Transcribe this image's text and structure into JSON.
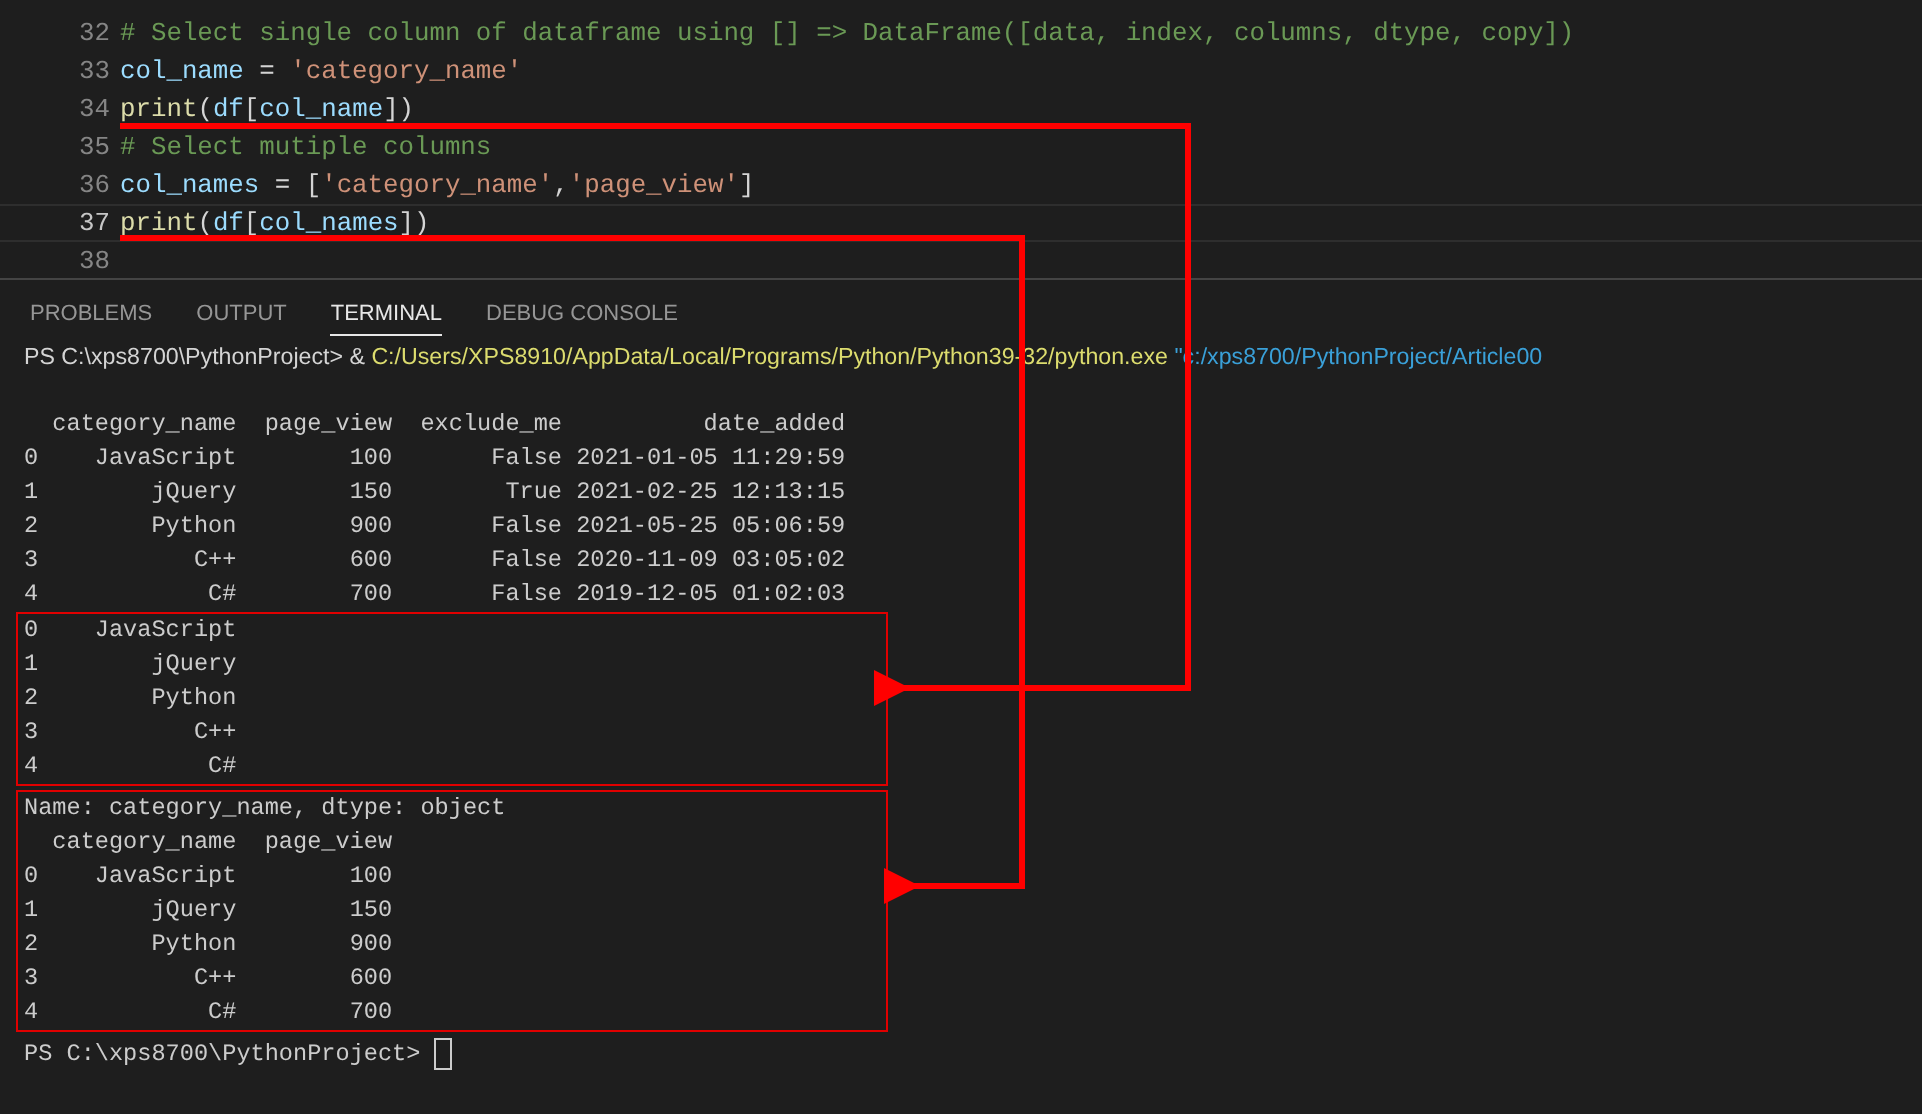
{
  "editor": {
    "lines": [
      {
        "number": "32",
        "current": false,
        "tokens": [
          {
            "kind": "comment",
            "text": "# Select single column of dataframe using [] => DataFrame([data, index, columns, dtype, copy])"
          }
        ]
      },
      {
        "number": "33",
        "current": false,
        "tokens": [
          {
            "kind": "var",
            "text": "col_name"
          },
          {
            "kind": "plain",
            "text": " = "
          },
          {
            "kind": "string",
            "text": "'category_name'"
          }
        ]
      },
      {
        "number": "34",
        "current": false,
        "tokens": [
          {
            "kind": "func",
            "text": "print"
          },
          {
            "kind": "plain",
            "text": "("
          },
          {
            "kind": "var",
            "text": "df"
          },
          {
            "kind": "plain",
            "text": "["
          },
          {
            "kind": "var",
            "text": "col_name"
          },
          {
            "kind": "plain",
            "text": "])"
          }
        ]
      },
      {
        "number": "35",
        "current": false,
        "tokens": [
          {
            "kind": "comment",
            "text": "# Select mutiple columns"
          }
        ]
      },
      {
        "number": "36",
        "current": false,
        "tokens": [
          {
            "kind": "var",
            "text": "col_names"
          },
          {
            "kind": "plain",
            "text": " = ["
          },
          {
            "kind": "string",
            "text": "'category_name'"
          },
          {
            "kind": "plain",
            "text": ","
          },
          {
            "kind": "string",
            "text": "'page_view'"
          },
          {
            "kind": "plain",
            "text": "]"
          }
        ]
      },
      {
        "number": "37",
        "current": true,
        "tokens": [
          {
            "kind": "func",
            "text": "print"
          },
          {
            "kind": "plain",
            "text": "("
          },
          {
            "kind": "var",
            "text": "df"
          },
          {
            "kind": "plain",
            "text": "["
          },
          {
            "kind": "var",
            "text": "col_names"
          },
          {
            "kind": "plain",
            "text": "])"
          }
        ]
      },
      {
        "number": "38",
        "current": false
      }
    ]
  },
  "panel": {
    "tabs": [
      {
        "label": "PROBLEMS",
        "selected": false
      },
      {
        "label": "OUTPUT",
        "selected": false
      },
      {
        "label": "TERMINAL",
        "selected": true
      },
      {
        "label": "DEBUG CONSOLE",
        "selected": false
      }
    ]
  },
  "terminal": {
    "command": [
      {
        "kind": "plain",
        "text": "PS C:\\xps8700\\PythonProject> & "
      },
      {
        "kind": "path",
        "text": "C:/Users/XPS8910/AppData/Local/Programs/Python/Python39-32/python.exe"
      },
      {
        "kind": "quoted",
        "text": " \"c:/xps8700/PythonProject/Article00"
      }
    ],
    "output": [
      "  category_name  page_view  exclude_me          date_added",
      "0    JavaScript        100       False 2021-01-05 11:29:59",
      "1        jQuery        150        True 2021-02-25 12:13:15",
      "2        Python        900       False 2021-05-25 05:06:59",
      "3           C++        600       False 2020-11-09 03:05:02",
      "4            C#        700       False 2019-12-05 01:02:03"
    ],
    "boxed_outputs": [
      [
        "0    JavaScript",
        "1        jQuery",
        "2        Python",
        "3           C++",
        "4            C#"
      ],
      [
        "Name: category_name, dtype: object",
        "  category_name  page_view",
        "0    JavaScript        100",
        "1        jQuery        150",
        "2        Python        900",
        "3           C++        600",
        "4            C#        700"
      ]
    ],
    "prompt": "PS C:\\xps8700\\PythonProject>"
  }
}
